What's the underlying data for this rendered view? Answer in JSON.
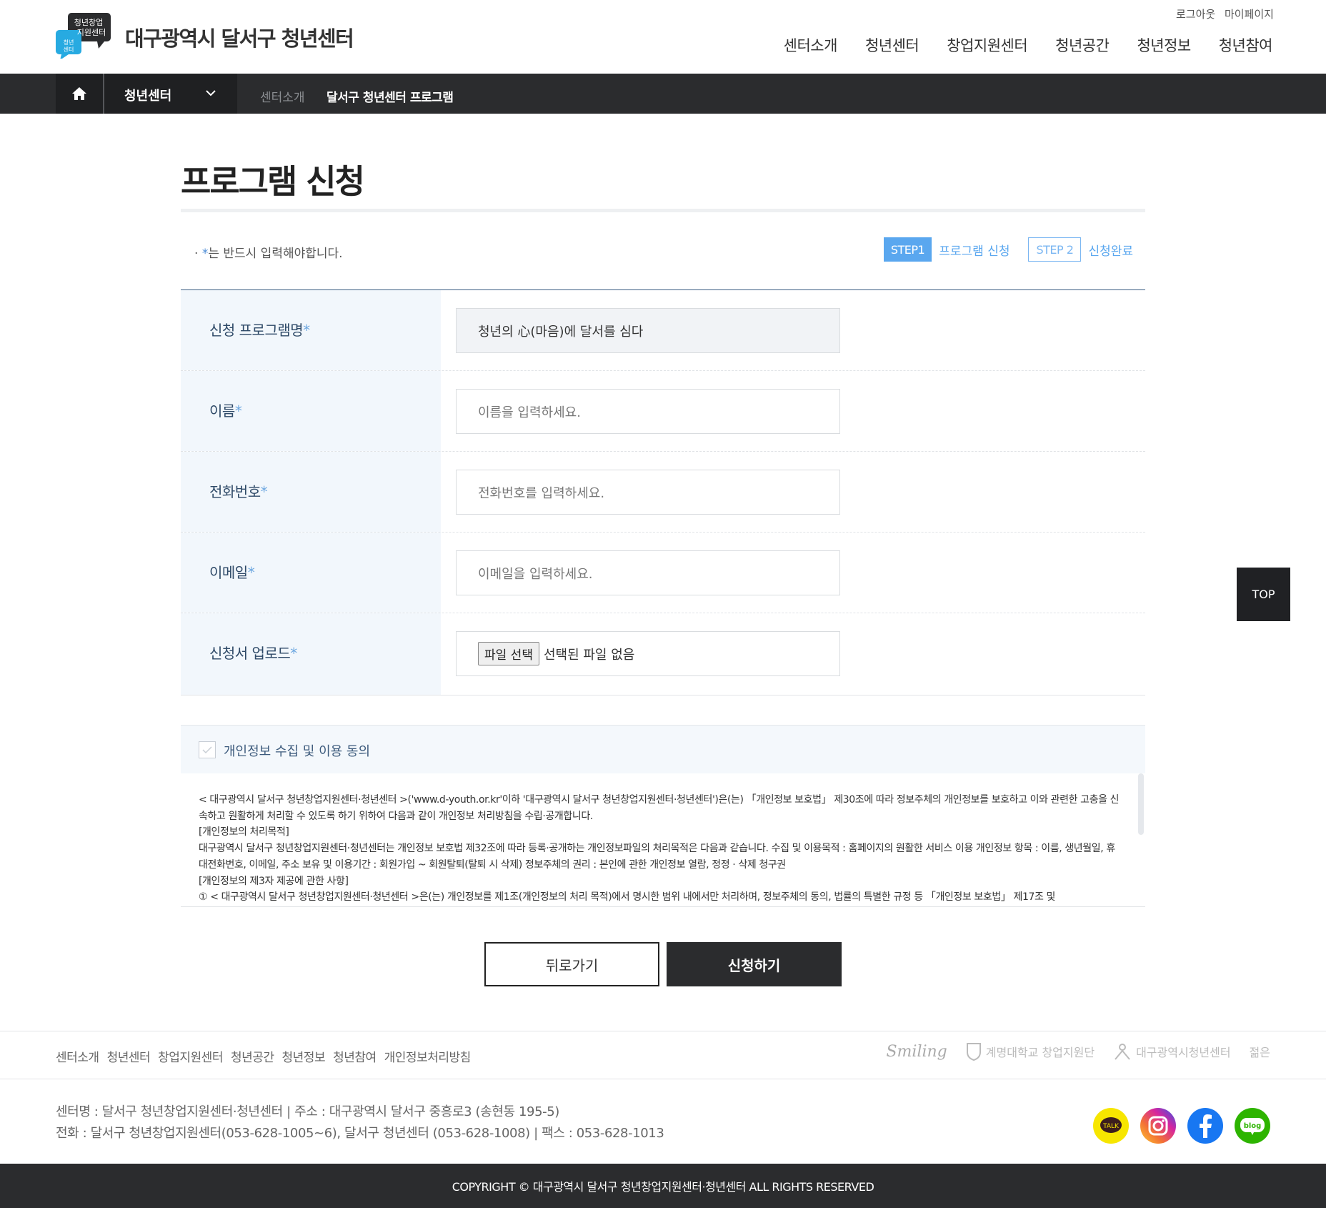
{
  "header": {
    "site_title": "대구광역시 달서구 청년센터",
    "logo_text_top": "청년창업",
    "logo_text_mid": "지원센터",
    "logo_text_bottom": "청년센터",
    "util": [
      "로그아웃",
      "마이페이지"
    ],
    "gnb": [
      "센터소개",
      "청년센터",
      "창업지원센터",
      "청년공간",
      "청년정보",
      "청년참여"
    ]
  },
  "subnav": {
    "selected": "청년센터",
    "crumb1": "센터소개",
    "crumb2": "달서구 청년센터 프로그램"
  },
  "main": {
    "title": "프로그램 신청",
    "required_note": "는 반드시 입력해야합니다.",
    "required_prefix": "· ",
    "star": "*",
    "steps": [
      {
        "badge": "STEP1",
        "label": "프로그램 신청"
      },
      {
        "badge": "STEP 2",
        "label": "신청완료"
      }
    ]
  },
  "form": {
    "rows": [
      {
        "label": "신청 프로그램명",
        "value": "청년의 心(마음)에 달서를 심다"
      },
      {
        "label": "이름",
        "placeholder": "이름을 입력하세요."
      },
      {
        "label": "전화번호",
        "placeholder": "전화번호를 입력하세요."
      },
      {
        "label": "이메일",
        "placeholder": "이메일을 입력하세요."
      },
      {
        "label": "신청서 업로드",
        "file_button": "파일 선택",
        "file_none": "선택된 파일 없음"
      }
    ]
  },
  "agree": {
    "label": "개인정보 수집 및 이용 동의",
    "policy": [
      "< 대구광역시 달서구 청년창업지원센터·청년센터 >('www.d-youth.or.kr'이하 '대구광역시 달서구 청년창업지원센터·청년센터')은(는) 「개인정보 보호법」 제30조에 따라 정보주체의 개인정보를 보호하고 이와 관련한 고충을 신속하고 원활하게 처리할 수 있도록 하기 위하여 다음과 같이 개인정보 처리방침을 수립·공개합니다.",
      "[개인정보의 처리목적]",
      "대구광역시 달서구 청년창업지원센터·청년센터는 개인정보 보호법 제32조에 따라 등록·공개하는 개인정보파일의 처리목적은 다음과 같습니다. 수집 및 이용목적 : 홈페이지의 원활한 서비스 이용 개인정보 항목 : 이름, 생년월일, 휴대전화번호, 이메일, 주소 보유 및 이용기간 : 회원가입 ~ 회원탈퇴(탈퇴 시 삭제) 정보주체의 권리 : 본인에 관한 개인정보 열람, 정정 · 삭제 청구권",
      "[개인정보의 제3자 제공에 관한 사항]",
      "① < 대구광역시 달서구 청년창업지원센터·청년센터 >은(는) 개인정보를 제1조(개인정보의 처리 목적)에서 명시한 범위 내에서만 처리하며, 정보주체의 동의, 법률의 특별한 규정 등 「개인정보 보호법」 제17조 및"
    ]
  },
  "buttons": {
    "back": "뒤로가기",
    "apply": "신청하기",
    "top": "TOP"
  },
  "footer": {
    "links": [
      "센터소개",
      "청년센터",
      "창업지원센터",
      "청년공간",
      "청년정보",
      "청년참여",
      "개인정보처리방침"
    ],
    "partners": [
      "Smiling",
      "계명대학교 창업지원단",
      "대구광역시청년센터",
      "젊은"
    ],
    "info_line1": "센터명 : 달서구 청년창업지원센터·청년센터 | 주소 : 대구광역시 달서구 중흥로3 (송현동 195-5)",
    "info_line2": "전화 : 달서구 청년창업지원센터(053-628-1005~6), 달서구 청년센터 (053-628-1008) | 팩스 : 053-628-1013",
    "sns": [
      {
        "name": "kakaotalk-icon",
        "label": "TALK",
        "color": "#f7e600"
      },
      {
        "name": "instagram-icon",
        "label": "",
        "color": "#d6249f"
      },
      {
        "name": "facebook-icon",
        "label": "",
        "color": "#1877f2"
      },
      {
        "name": "blog-icon",
        "label": "blog",
        "color": "#2db400"
      }
    ],
    "copyright": "COPYRIGHT © 대구광역시 달서구 청년창업지원센터·청년센터 ALL RIGHTS RESERVED"
  },
  "colors": {
    "accent": "#5aa7ef",
    "label_bg": "#f2f7fc",
    "dark": "#2b2c2e"
  }
}
